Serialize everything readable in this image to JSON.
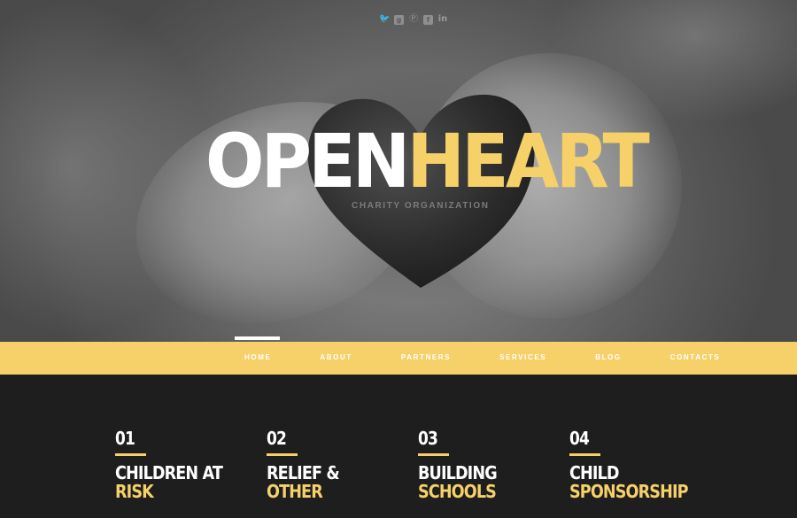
{
  "social": {
    "icons": [
      "twitter-icon",
      "google-plus-icon",
      "pinterest-icon",
      "facebook-icon",
      "linkedin-icon"
    ]
  },
  "brand": {
    "logo_part1": "OPEN",
    "logo_part2": "HEART",
    "tagline": "CHARITY ORGANIZATION"
  },
  "nav": {
    "items": [
      "HOME",
      "ABOUT",
      "PARTNERS",
      "SERVICES",
      "BLOG",
      "CONTACTS"
    ],
    "active": "HOME"
  },
  "services": [
    {
      "num": "01",
      "line1": "CHILDREN AT",
      "line2": "RISK"
    },
    {
      "num": "02",
      "line1": "RELIEF &",
      "line2": "OTHER"
    },
    {
      "num": "03",
      "line1": "BUILDING",
      "line2": "SCHOOLS"
    },
    {
      "num": "04",
      "line1": "CHILD",
      "line2": "SPONSORSHIP"
    }
  ],
  "colors": {
    "accent": "#f6d16a",
    "dark": "#1e1e1e",
    "white": "#ffffff"
  }
}
